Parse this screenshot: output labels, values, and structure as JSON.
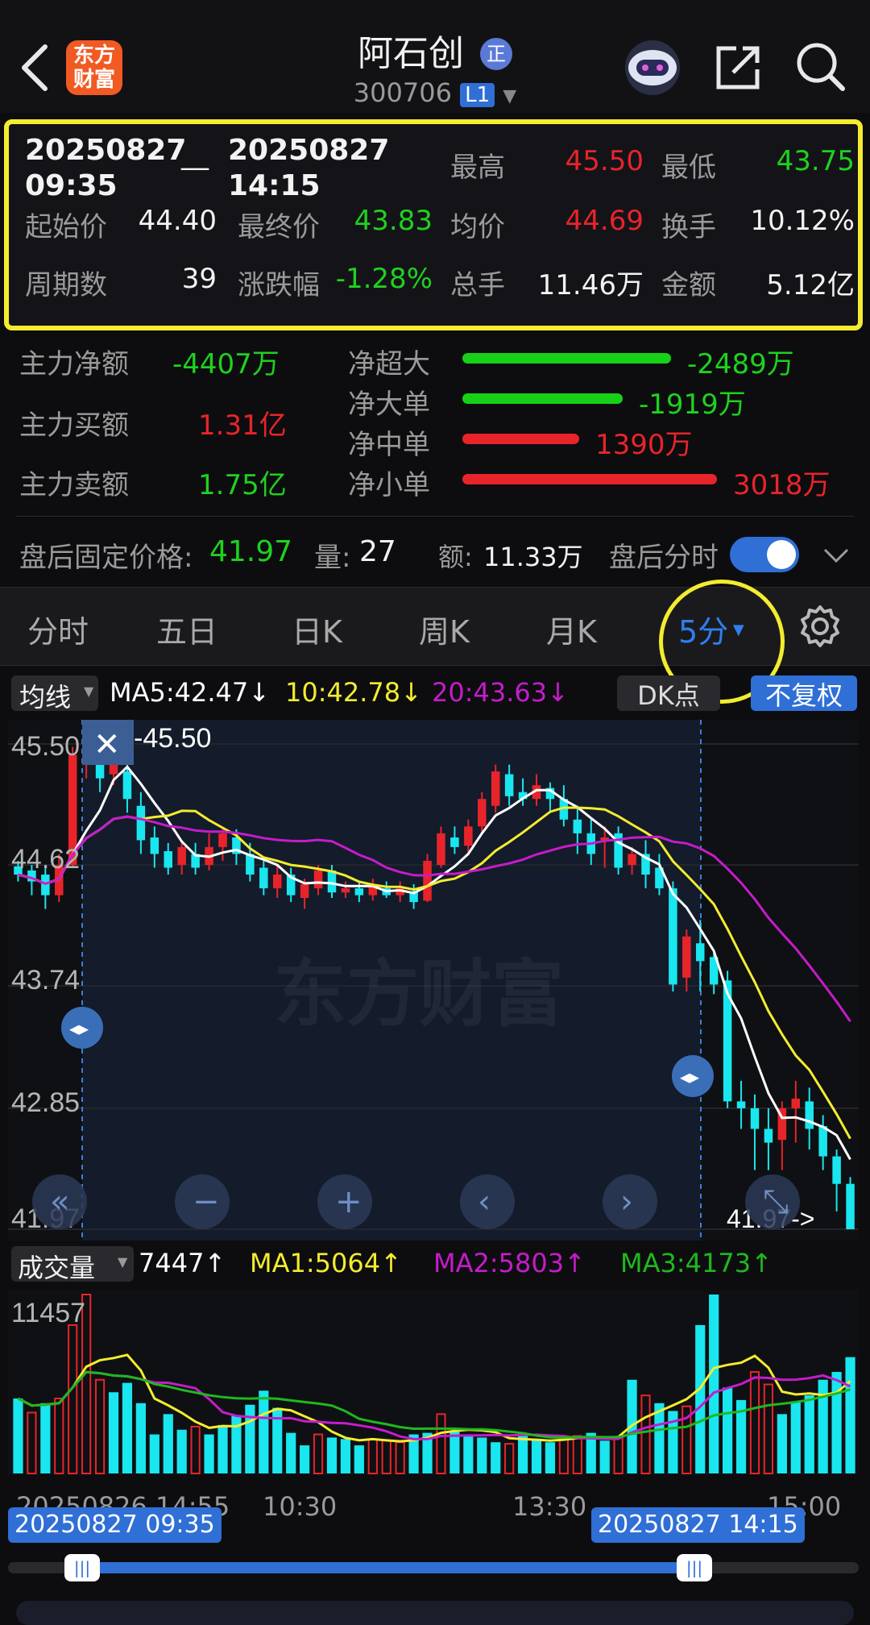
{
  "header": {
    "title": "阿石创",
    "badge": "正",
    "code": "300706",
    "level": "L1",
    "logo_line1": "东方",
    "logo_line2": "财富"
  },
  "summary": {
    "start_date": "20250827",
    "start_time": "09:35",
    "dash": "__",
    "end_date": "20250827",
    "end_time": "14:15",
    "high_label": "最高",
    "high": "45.50",
    "low_label": "最低",
    "low": "43.75",
    "open_label": "起始价",
    "open": "44.40",
    "close_label": "最终价",
    "close": "43.83",
    "avg_label": "均价",
    "avg": "44.69",
    "turnover_label": "换手",
    "turnover": "10.12%",
    "periods_label": "周期数",
    "periods": "39",
    "change_label": "涨跌幅",
    "change": "-1.28%",
    "volume_label": "总手",
    "volume": "11.46万",
    "amount_label": "金额",
    "amount": "5.12亿"
  },
  "flow": {
    "net_label": "主力净额",
    "net": "-4407万",
    "buy_label": "主力买额",
    "buy": "1.31亿",
    "sell_label": "主力卖额",
    "sell": "1.75亿",
    "items": [
      {
        "label": "净超大",
        "value": "-2489万",
        "ratio": 0.82,
        "color": "#17d117"
      },
      {
        "label": "净大单",
        "value": "-1919万",
        "ratio": 0.63,
        "color": "#17d117"
      },
      {
        "label": "净中单",
        "value": "1390万",
        "ratio": 0.46,
        "color": "#e8242b"
      },
      {
        "label": "净小单",
        "value": "3018万",
        "ratio": 1.0,
        "color": "#e8242b"
      }
    ]
  },
  "after_hours": {
    "price_label": "盘后固定价格:",
    "price": "41.97",
    "qty_label": "量:",
    "qty": "27",
    "amt_label": "额:",
    "amt": "11.33万",
    "toggle_label": "盘后分时"
  },
  "tabs": [
    "分时",
    "五日",
    "日K",
    "周K",
    "月K",
    "5分"
  ],
  "ma_bar": {
    "selector": "均线",
    "ma5": "MA5:42.47↓",
    "ma10": "10:42.78↓",
    "ma20": "20:43.63↓",
    "dk": "DK点",
    "fq": "不复权"
  },
  "chart_labels": {
    "y1": "45.50",
    "y2": "44.62",
    "y3": "43.74",
    "y4": "42.85",
    "y5": "41.97",
    "hi_tag": "-45.50",
    "last_tag": "41.97->",
    "watermark": "东方财富"
  },
  "vol_bar": {
    "selector": "成交量",
    "vol": "7447↑",
    "ma1": "MA1:5064↑",
    "ma2": "MA2:5803↑",
    "ma3": "MA3:4173↑",
    "ymax": "11457"
  },
  "time_axis": {
    "t0": "20250826 14:55",
    "t1": "10:30",
    "t2": "13:30",
    "t3": "15:00",
    "sel_start": "20250827 09:35",
    "sel_end": "20250827 14:15"
  },
  "colors": {
    "up": "#e8242b",
    "down": "#19e6ef",
    "ma5": "#ffffff",
    "ma10": "#f3ec2f",
    "ma20": "#c51ccb",
    "vol_ma3": "#1fb81f",
    "accent": "#2f6fd6"
  },
  "chart_data": {
    "type": "candlestick",
    "y_ticks": [
      45.5,
      44.62,
      43.74,
      42.85,
      41.97
    ],
    "ylim": [
      41.97,
      45.5
    ],
    "candles": [
      [
        44.61,
        44.55,
        44.65,
        44.5
      ],
      [
        44.58,
        44.5,
        44.62,
        44.4
      ],
      [
        44.55,
        44.4,
        44.62,
        44.3
      ],
      [
        44.4,
        44.62,
        44.7,
        44.35
      ],
      [
        44.62,
        45.42,
        45.48,
        44.6
      ],
      [
        45.35,
        45.4,
        45.45,
        45.25
      ],
      [
        45.4,
        45.25,
        45.5,
        45.15
      ],
      [
        45.28,
        45.5,
        45.5,
        45.2
      ],
      [
        45.3,
        45.1,
        45.35,
        45.0
      ],
      [
        45.05,
        44.8,
        45.15,
        44.7
      ],
      [
        44.82,
        44.7,
        44.9,
        44.6
      ],
      [
        44.72,
        44.6,
        44.78,
        44.55
      ],
      [
        44.62,
        44.75,
        44.8,
        44.55
      ],
      [
        44.7,
        44.6,
        44.78,
        44.55
      ],
      [
        44.62,
        44.75,
        44.85,
        44.58
      ],
      [
        44.75,
        44.85,
        44.9,
        44.65
      ],
      [
        44.82,
        44.7,
        44.88,
        44.62
      ],
      [
        44.7,
        44.55,
        44.78,
        44.5
      ],
      [
        44.6,
        44.45,
        44.65,
        44.4
      ],
      [
        44.45,
        44.55,
        44.62,
        44.38
      ],
      [
        44.55,
        44.4,
        44.6,
        44.35
      ],
      [
        44.38,
        44.48,
        44.52,
        44.3
      ],
      [
        44.45,
        44.58,
        44.62,
        44.4
      ],
      [
        44.58,
        44.42,
        44.62,
        44.38
      ],
      [
        44.42,
        44.45,
        44.5,
        44.38
      ],
      [
        44.45,
        44.4,
        44.5,
        44.35
      ],
      [
        44.4,
        44.48,
        44.52,
        44.36
      ],
      [
        44.45,
        44.4,
        44.5,
        44.38
      ],
      [
        44.4,
        44.45,
        44.5,
        44.35
      ],
      [
        44.42,
        44.35,
        44.48,
        44.3
      ],
      [
        44.36,
        44.65,
        44.7,
        44.35
      ],
      [
        44.62,
        44.85,
        44.9,
        44.6
      ],
      [
        44.82,
        44.75,
        44.9,
        44.7
      ],
      [
        44.76,
        44.9,
        44.95,
        44.7
      ],
      [
        44.9,
        45.1,
        45.15,
        44.85
      ],
      [
        45.05,
        45.3,
        45.35,
        45.0
      ],
      [
        45.28,
        45.12,
        45.35,
        45.05
      ],
      [
        45.15,
        45.1,
        45.25,
        45.05
      ],
      [
        45.1,
        45.2,
        45.28,
        45.05
      ],
      [
        45.18,
        45.1,
        45.22,
        45.0
      ],
      [
        45.1,
        44.95,
        45.2,
        44.9
      ],
      [
        44.95,
        44.85,
        45.05,
        44.7
      ],
      [
        44.85,
        44.7,
        44.95,
        44.62
      ],
      [
        44.8,
        44.82,
        44.9,
        44.6
      ],
      [
        44.85,
        44.6,
        44.9,
        44.55
      ],
      [
        44.62,
        44.7,
        44.75,
        44.55
      ],
      [
        44.7,
        44.55,
        44.8,
        44.45
      ],
      [
        44.6,
        44.45,
        44.7,
        44.4
      ],
      [
        44.45,
        43.75,
        44.5,
        43.7
      ],
      [
        43.8,
        44.1,
        44.15,
        43.7
      ],
      [
        44.05,
        43.92,
        44.22,
        43.7
      ],
      [
        43.95,
        43.75,
        44.0,
        43.68
      ],
      [
        43.78,
        42.9,
        43.85,
        42.85
      ],
      [
        42.9,
        42.85,
        43.05,
        42.7
      ],
      [
        42.85,
        42.7,
        42.95,
        42.4
      ],
      [
        42.7,
        42.6,
        42.85,
        42.4
      ],
      [
        42.62,
        42.85,
        42.9,
        42.4
      ],
      [
        42.85,
        42.92,
        43.05,
        42.6
      ],
      [
        42.9,
        42.7,
        43.0,
        42.55
      ],
      [
        42.72,
        42.5,
        42.8,
        42.4
      ],
      [
        42.5,
        42.3,
        42.55,
        42.1
      ],
      [
        42.3,
        41.97,
        42.35,
        41.97
      ]
    ],
    "volumes": [
      [
        4800,
        0
      ],
      [
        3900,
        1
      ],
      [
        4500,
        0
      ],
      [
        4800,
        1
      ],
      [
        9500,
        1
      ],
      [
        11457,
        1
      ],
      [
        6000,
        1
      ],
      [
        5200,
        0
      ],
      [
        5800,
        0
      ],
      [
        4500,
        0
      ],
      [
        2500,
        0
      ],
      [
        3800,
        0
      ],
      [
        2800,
        0
      ],
      [
        3000,
        1
      ],
      [
        2500,
        0
      ],
      [
        3100,
        0
      ],
      [
        3700,
        0
      ],
      [
        4400,
        0
      ],
      [
        5300,
        0
      ],
      [
        4200,
        0
      ],
      [
        2600,
        0
      ],
      [
        1800,
        0
      ],
      [
        2500,
        1
      ],
      [
        2300,
        0
      ],
      [
        2200,
        0
      ],
      [
        1800,
        0
      ],
      [
        2200,
        1
      ],
      [
        2100,
        1
      ],
      [
        2000,
        1
      ],
      [
        2500,
        0
      ],
      [
        2600,
        0
      ],
      [
        3800,
        1
      ],
      [
        2700,
        0
      ],
      [
        2400,
        0
      ],
      [
        2300,
        0
      ],
      [
        2000,
        0
      ],
      [
        1900,
        1
      ],
      [
        2400,
        0
      ],
      [
        2200,
        0
      ],
      [
        2000,
        0
      ],
      [
        2300,
        1
      ],
      [
        2400,
        1
      ],
      [
        2600,
        0
      ],
      [
        2100,
        0
      ],
      [
        2300,
        1
      ],
      [
        6000,
        0
      ],
      [
        5000,
        1
      ],
      [
        4500,
        0
      ],
      [
        4000,
        0
      ],
      [
        4300,
        1
      ],
      [
        9500,
        0
      ],
      [
        11457,
        0
      ],
      [
        5500,
        0
      ],
      [
        4700,
        0
      ],
      [
        6500,
        1
      ],
      [
        5700,
        1
      ],
      [
        3800,
        0
      ],
      [
        4600,
        0
      ],
      [
        5000,
        0
      ],
      [
        6000,
        0
      ],
      [
        6500,
        0
      ],
      [
        7447,
        0
      ]
    ]
  }
}
